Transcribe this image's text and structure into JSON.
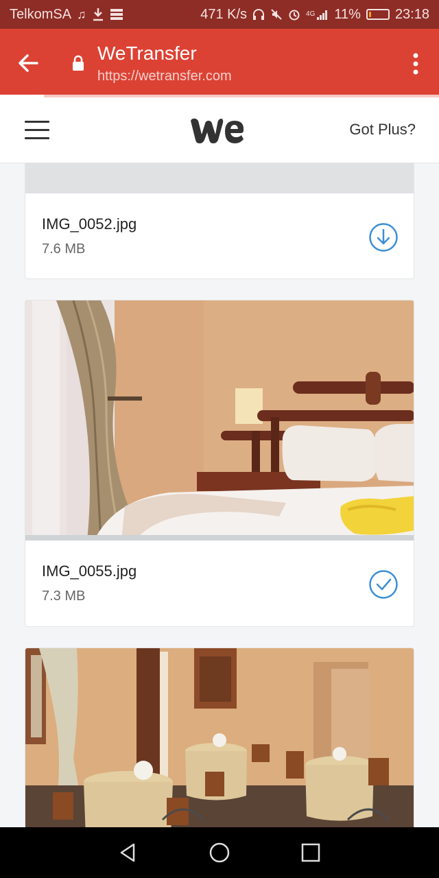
{
  "status_bar": {
    "carrier": "TelkomSA",
    "speed": "471 K/s",
    "network": "4G",
    "battery": "11%",
    "battery_level": 0.11,
    "time": "23:18"
  },
  "browser": {
    "title": "WeTransfer",
    "url": "https://wetransfer.com",
    "load_progress": 0.1
  },
  "header": {
    "got_plus": "Got Plus?"
  },
  "files": [
    {
      "name": "IMG_0052.jpg",
      "size": "7.6 MB",
      "status": "download"
    },
    {
      "name": "IMG_0055.jpg",
      "size": "7.3 MB",
      "status": "downloaded"
    }
  ],
  "colors": {
    "status_bar": "#8e2c26",
    "browser_bar": "#dc4234",
    "accent_blue": "#3b8fd6"
  }
}
